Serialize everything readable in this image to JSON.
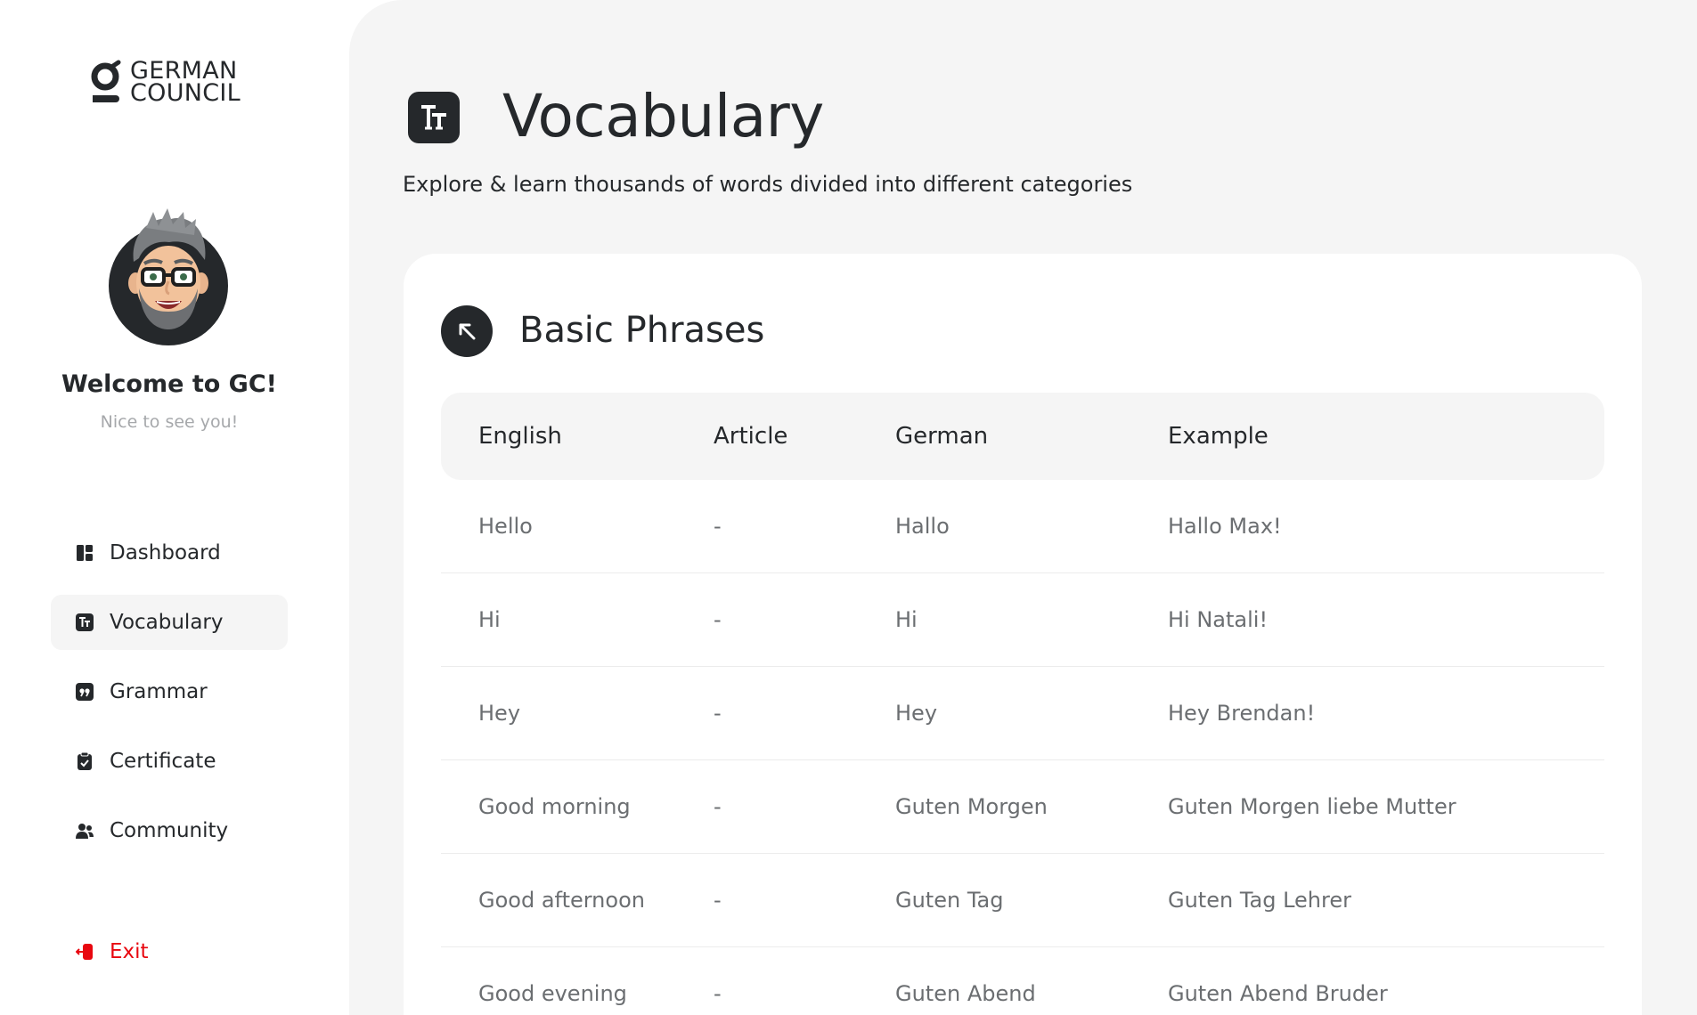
{
  "brand": {
    "line1": "GERMAN",
    "line2": "COUNCIL"
  },
  "profile": {
    "welcome": "Welcome to GC!",
    "subtitle": "Nice to see you!"
  },
  "nav": {
    "items": [
      {
        "label": "Dashboard",
        "icon": "dashboard-icon",
        "active": false
      },
      {
        "label": "Vocabulary",
        "icon": "text-size-icon",
        "active": true
      },
      {
        "label": "Grammar",
        "icon": "quote-icon",
        "active": false
      },
      {
        "label": "Certificate",
        "icon": "clipboard-check-icon",
        "active": false
      },
      {
        "label": "Community",
        "icon": "users-icon",
        "active": false
      }
    ],
    "exit_label": "Exit"
  },
  "page": {
    "title": "Vocabulary",
    "subtitle": "Explore & learn thousands of words divided into different categories"
  },
  "category": {
    "title": "Basic Phrases"
  },
  "table": {
    "headers": [
      "English",
      "Article",
      "German",
      "Example"
    ],
    "rows": [
      [
        "Hello",
        "-",
        "Hallo",
        "Hallo Max!"
      ],
      [
        "Hi",
        "-",
        "Hi",
        "Hi Natali!"
      ],
      [
        "Hey",
        "-",
        "Hey",
        "Hey Brendan!"
      ],
      [
        "Good morning",
        "-",
        "Guten Morgen",
        "Guten Morgen liebe Mutter"
      ],
      [
        "Good afternoon",
        "-",
        "Guten Tag",
        "Guten Tag Lehrer"
      ],
      [
        "Good evening",
        "-",
        "Guten Abend",
        "Guten Abend Bruder"
      ]
    ]
  },
  "colors": {
    "dark": "#25282b",
    "background": "#f5f5f5",
    "muted_text": "#6b6e71",
    "exit_red": "#e8070f"
  }
}
